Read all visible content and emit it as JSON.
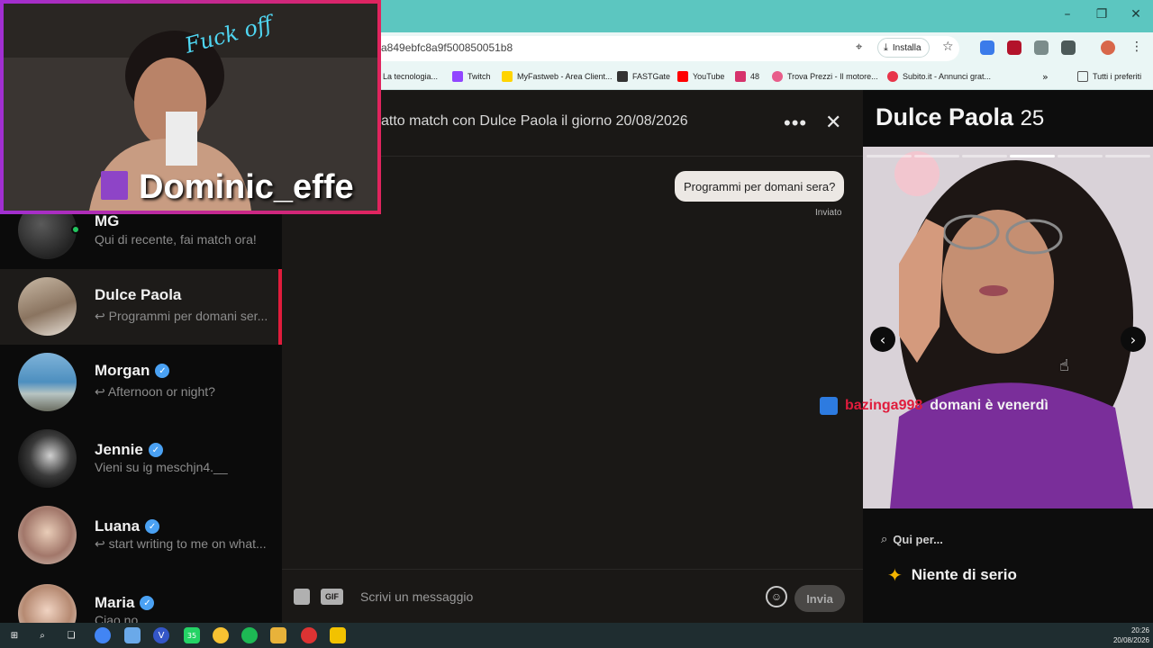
{
  "browser": {
    "url_visible": "a849ebfc8a9f500850051b8",
    "install_label": "Installa",
    "bookmarks": [
      {
        "label": "t La tecnologia...",
        "color": "#f7b500"
      },
      {
        "label": "Twitch",
        "color": "#9146ff"
      },
      {
        "label": "MyFastweb - Area Client...",
        "color": "#ffd400"
      },
      {
        "label": "FASTGate",
        "color": "#333333"
      },
      {
        "label": "YouTube",
        "color": "#ff0000"
      },
      {
        "label": "48",
        "color": "#d6336c"
      },
      {
        "label": "Trova Prezzi - Il motore...",
        "color": "#e85d8a"
      },
      {
        "label": "Subito.it - Annunci grat...",
        "color": "#e8344a"
      }
    ],
    "all_bookmarks_label": "Tutti i preferiti"
  },
  "conversations": [
    {
      "name": "MG",
      "preview": "Qui di recente, fai match ora!",
      "verified": false,
      "online": true,
      "active": false
    },
    {
      "name": "Dulce Paola",
      "preview": "↩ Programmi per domani ser...",
      "verified": false,
      "online": false,
      "active": true
    },
    {
      "name": "Morgan",
      "preview": "↩ Afternoon or night?",
      "verified": true,
      "online": false,
      "active": false
    },
    {
      "name": "Jennie",
      "preview": "Vieni su ig meschjn4.__",
      "verified": true,
      "online": false,
      "active": false
    },
    {
      "name": "Luana",
      "preview": "↩ start writing to me on what...",
      "verified": true,
      "online": false,
      "active": false
    },
    {
      "name": "Maria",
      "preview": "Ciao no",
      "verified": true,
      "online": false,
      "active": false
    }
  ],
  "chat": {
    "header": "atto match con Dulce Paola il giorno 20/08/2026",
    "messages": [
      {
        "text": "Programmi per domani sera?",
        "status": "Inviato"
      }
    ],
    "input_placeholder": "Scrivi un messaggio",
    "send_label": "Invia",
    "gif_label": "GIF"
  },
  "profile": {
    "name": "Dulce Paola",
    "age": "25",
    "looking_for_label": "Qui per...",
    "intent": "Niente di serio",
    "photo_count": 6,
    "active_photo": 4
  },
  "overlay": {
    "webcam_text_top": "Fuck off",
    "streamer_name": "Dominic_effe",
    "chat_user": "bazinga998",
    "chat_message": "domani è venerdì"
  },
  "taskbar": {
    "whatsapp_badge": "35",
    "time": "20:26",
    "date": "20/08/2026"
  },
  "colors": {
    "titlebar": "#5cc6c0",
    "accent_active": "#e01c3c",
    "verified": "#4aa1f3"
  }
}
